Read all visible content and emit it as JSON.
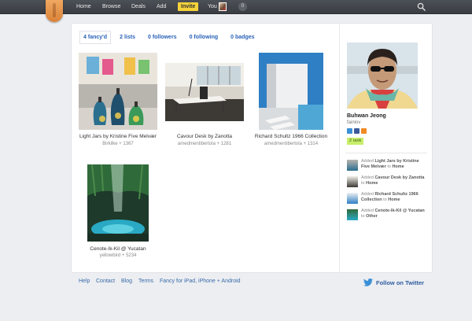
{
  "nav": {
    "items": [
      "Home",
      "Browse",
      "Deals",
      "Add"
    ],
    "invite": "Invite",
    "you": "You",
    "notifications": "0"
  },
  "tabs": [
    {
      "count": "4",
      "label": "fancy'd"
    },
    {
      "count": "2",
      "label": "lists"
    },
    {
      "count": "0",
      "label": "followers"
    },
    {
      "count": "0",
      "label": "following"
    },
    {
      "count": "0",
      "label": "badges"
    }
  ],
  "items": [
    {
      "title": "Light Jars by Kristine Five Melvær",
      "meta": "Birkilke + 1367"
    },
    {
      "title": "Cavour Desk by Zanotta",
      "meta": "amedmentibertola + 1281"
    },
    {
      "title": "Richard Schultz 1966 Collection",
      "meta": "amedmentibertola + 1314"
    },
    {
      "title": "Cenote-Ik-Kil @ Yucatan",
      "meta": "yellowbird + 5234"
    }
  ],
  "profile": {
    "name": "Buhwan Jeong",
    "username": "fainlov",
    "rank": "2 rank"
  },
  "activity": [
    {
      "prefix": "Added",
      "item": "Light Jars by Kristine Five Melvær",
      "mid": "to",
      "dest": "Home"
    },
    {
      "prefix": "Added",
      "item": "Cavour Desk by Zanotta",
      "mid": "to",
      "dest": "Home"
    },
    {
      "prefix": "Added",
      "item": "Richard Schultz 1966 Collection",
      "mid": "to",
      "dest": "Home"
    },
    {
      "prefix": "Added",
      "item": "Cenote-Ik-Kil @ Yucatan",
      "mid": "to",
      "dest": "Other"
    }
  ],
  "footer": {
    "links": [
      "Help",
      "Contact",
      "Blog",
      "Terms",
      "Fancy for iPad, iPhone + Android"
    ],
    "follow": "Follow on Twitter"
  },
  "colors": {
    "accent": "#2a62b8",
    "invite": "#f5d33a",
    "rank": "#c8ee6a"
  }
}
